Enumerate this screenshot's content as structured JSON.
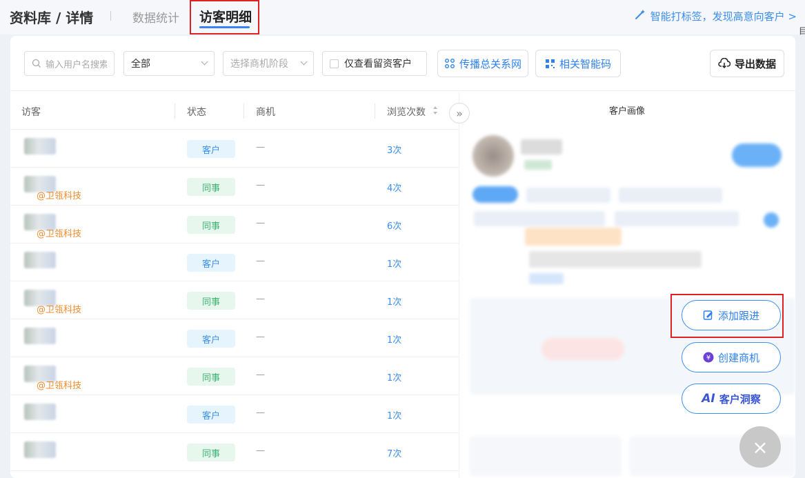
{
  "header": {
    "breadcrumb": "资料库 / 详情",
    "tabs": [
      {
        "label": "数据统计",
        "active": false
      },
      {
        "label": "访客明细",
        "active": true
      }
    ],
    "promo": "智能打标签，发现高意向客户 >"
  },
  "filters": {
    "search_placeholder": "输入用户名搜索",
    "type_select": "全部",
    "stage_placeholder": "选择商机阶段",
    "checkbox_label": "仅查看留资客户",
    "relation_button": "传播总关系网",
    "smart_code_button": "相关智能码",
    "export_button": "导出数据"
  },
  "table": {
    "headers": [
      "访客",
      "状态",
      "商机",
      "浏览次数"
    ],
    "rows": [
      {
        "company": "",
        "status": "客户",
        "opportunity": "—",
        "views": "3次"
      },
      {
        "company": "@卫瓴科技",
        "status": "同事",
        "opportunity": "—",
        "views": "4次"
      },
      {
        "company": "@卫瓴科技",
        "status": "同事",
        "opportunity": "—",
        "views": "6次"
      },
      {
        "company": "",
        "status": "客户",
        "opportunity": "—",
        "views": "1次"
      },
      {
        "company": "@卫瓴科技",
        "status": "同事",
        "opportunity": "—",
        "views": "1次"
      },
      {
        "company": "",
        "status": "客户",
        "opportunity": "—",
        "views": "1次"
      },
      {
        "company": "@卫瓴科技",
        "status": "同事",
        "opportunity": "—",
        "views": "1次"
      },
      {
        "company": "",
        "status": "客户",
        "opportunity": "—",
        "views": "1次"
      },
      {
        "company": "",
        "status": "同事",
        "opportunity": "—",
        "views": "7次"
      }
    ]
  },
  "profile": {
    "title": "客户画像"
  },
  "actions": {
    "add_followup": "添加跟进",
    "create_opportunity": "创建商机",
    "ai_insight": "客户洞察"
  },
  "colors": {
    "accent": "#3b8ef0",
    "company": "#f08a2c",
    "highlight": "#e02020"
  }
}
